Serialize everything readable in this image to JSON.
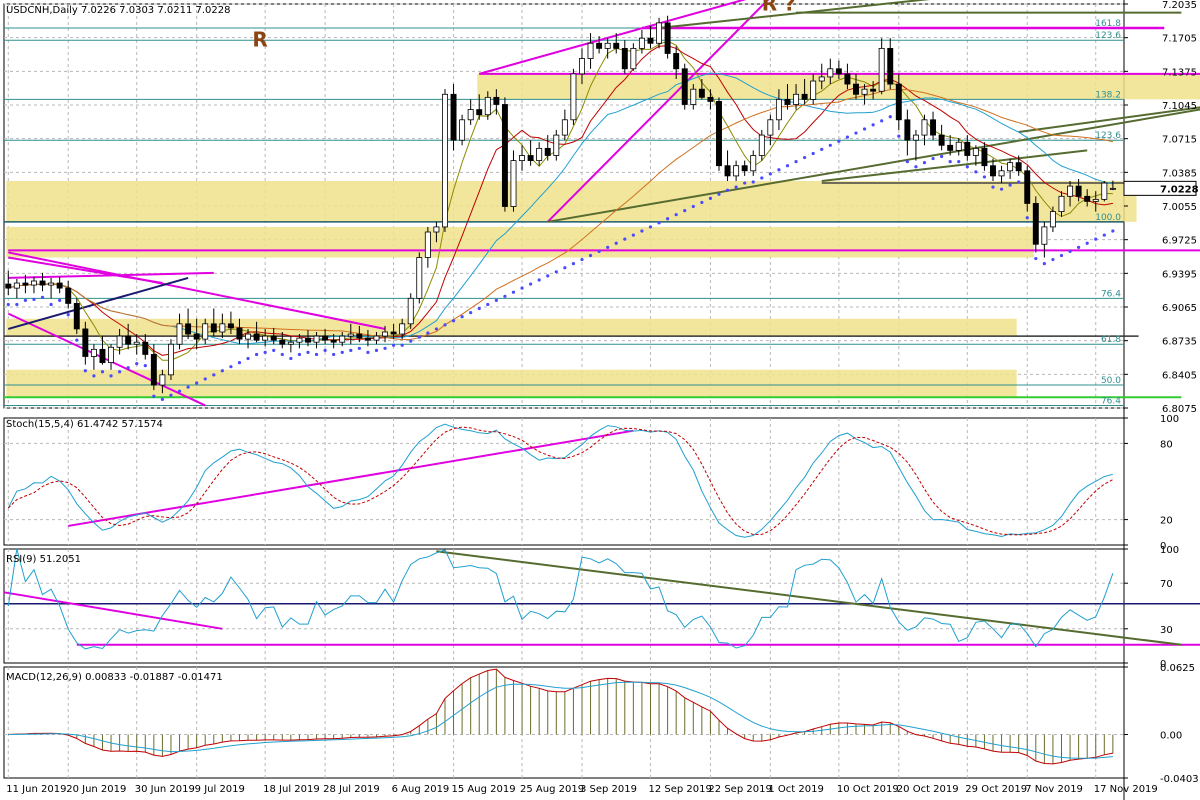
{
  "chart_data": [
    {
      "id": "price",
      "type": "candlestick",
      "title": "USDCNH,Daily",
      "ohlc_text": "7.0226 7.0303 7.0211 7.0228",
      "current_price_label": "7.0228",
      "ylim": [
        6.8075,
        7.2035
      ],
      "y_ticks": [
        "7.2035",
        "7.1705",
        "7.1375",
        "7.1045",
        "7.0715",
        "7.0385",
        "7.0055",
        "6.9725",
        "6.9395",
        "6.9065",
        "6.8735",
        "6.8405",
        "6.8075"
      ],
      "fib_labels": [
        {
          "text": "161.8",
          "value": 7.18
        },
        {
          "text": "123.6",
          "value": 7.168
        },
        {
          "text": "138.2",
          "value": 7.11
        },
        {
          "text": "123.6",
          "value": 7.07
        },
        {
          "text": "100.0",
          "value": 6.99
        },
        {
          "text": "76.4",
          "value": 6.915
        },
        {
          "text": "61.8",
          "value": 6.87
        },
        {
          "text": "50.0",
          "value": 6.83
        },
        {
          "text": "76.4",
          "value": 6.81
        }
      ],
      "annotations": [
        {
          "text": "R",
          "x": 28.5,
          "value": 7.162
        },
        {
          "text": "R ?",
          "x": 88,
          "value": 7.197
        }
      ],
      "candles": [
        [
          6.929,
          6.942,
          6.918,
          6.925
        ],
        [
          6.925,
          6.934,
          6.915,
          6.93
        ],
        [
          6.93,
          6.938,
          6.92,
          6.928
        ],
        [
          6.928,
          6.936,
          6.92,
          6.932
        ],
        [
          6.932,
          6.94,
          6.922,
          6.928
        ],
        [
          6.928,
          6.935,
          6.915,
          6.93
        ],
        [
          6.93,
          6.936,
          6.92,
          6.925
        ],
        [
          6.925,
          6.932,
          6.905,
          6.91
        ],
        [
          6.91,
          6.915,
          6.88,
          6.885
        ],
        [
          6.885,
          6.892,
          6.85,
          6.858
        ],
        [
          6.858,
          6.87,
          6.845,
          6.865
        ],
        [
          6.865,
          6.878,
          6.85,
          6.852
        ],
        [
          6.852,
          6.87,
          6.845,
          6.867
        ],
        [
          6.867,
          6.885,
          6.86,
          6.878
        ],
        [
          6.878,
          6.89,
          6.865,
          6.87
        ],
        [
          6.87,
          6.88,
          6.86,
          6.872
        ],
        [
          6.872,
          6.88,
          6.855,
          6.86
        ],
        [
          6.86,
          6.87,
          6.825,
          6.83
        ],
        [
          6.83,
          6.845,
          6.822,
          6.84
        ],
        [
          6.84,
          6.875,
          6.835,
          6.87
        ],
        [
          6.87,
          6.9,
          6.865,
          6.89
        ],
        [
          6.89,
          6.905,
          6.875,
          6.88
        ],
        [
          6.88,
          6.895,
          6.865,
          6.875
        ],
        [
          6.875,
          6.895,
          6.87,
          6.89
        ],
        [
          6.89,
          6.905,
          6.878,
          6.882
        ],
        [
          6.882,
          6.9,
          6.876,
          6.89
        ],
        [
          6.89,
          6.902,
          6.88,
          6.886
        ],
        [
          6.886,
          6.895,
          6.87,
          6.875
        ],
        [
          6.875,
          6.885,
          6.866,
          6.88
        ],
        [
          6.88,
          6.892,
          6.872,
          6.874
        ],
        [
          6.874,
          6.885,
          6.868,
          6.878
        ],
        [
          6.878,
          6.886,
          6.87,
          6.874
        ],
        [
          6.874,
          6.882,
          6.866,
          6.87
        ],
        [
          6.87,
          6.878,
          6.862,
          6.872
        ],
        [
          6.872,
          6.88,
          6.866,
          6.876
        ],
        [
          6.876,
          6.884,
          6.868,
          6.872
        ],
        [
          6.872,
          6.882,
          6.866,
          6.878
        ],
        [
          6.878,
          6.885,
          6.87,
          6.874
        ],
        [
          6.874,
          6.88,
          6.866,
          6.872
        ],
        [
          6.872,
          6.882,
          6.868,
          6.878
        ],
        [
          6.878,
          6.89,
          6.87,
          6.88
        ],
        [
          6.88,
          6.888,
          6.872,
          6.876
        ],
        [
          6.876,
          6.884,
          6.868,
          6.874
        ],
        [
          6.874,
          6.882,
          6.87,
          6.878
        ],
        [
          6.878,
          6.888,
          6.872,
          6.882
        ],
        [
          6.882,
          6.89,
          6.875,
          6.88
        ],
        [
          6.88,
          6.895,
          6.875,
          6.89
        ],
        [
          6.89,
          6.92,
          6.885,
          6.915
        ],
        [
          6.915,
          6.96,
          6.91,
          6.955
        ],
        [
          6.955,
          6.985,
          6.945,
          6.98
        ],
        [
          6.98,
          6.99,
          6.97,
          6.985
        ],
        [
          6.985,
          7.12,
          6.98,
          7.115
        ],
        [
          7.115,
          7.125,
          7.06,
          7.07
        ],
        [
          7.07,
          7.095,
          7.065,
          7.09
        ],
        [
          7.09,
          7.11,
          7.085,
          7.1
        ],
        [
          7.1,
          7.115,
          7.09,
          7.095
        ],
        [
          7.095,
          7.118,
          7.09,
          7.112
        ],
        [
          7.112,
          7.12,
          7.095,
          7.105
        ],
        [
          7.105,
          7.112,
          7.0,
          7.005
        ],
        [
          7.005,
          7.06,
          7.0,
          7.05
        ],
        [
          7.05,
          7.065,
          7.04,
          7.055
        ],
        [
          7.055,
          7.07,
          7.045,
          7.05
        ],
        [
          7.05,
          7.068,
          7.045,
          7.062
        ],
        [
          7.062,
          7.075,
          7.05,
          7.055
        ],
        [
          7.055,
          7.08,
          7.05,
          7.075
        ],
        [
          7.075,
          7.1,
          7.07,
          7.09
        ],
        [
          7.09,
          7.14,
          7.085,
          7.135
        ],
        [
          7.135,
          7.16,
          7.125,
          7.15
        ],
        [
          7.15,
          7.175,
          7.14,
          7.165
        ],
        [
          7.165,
          7.172,
          7.155,
          7.16
        ],
        [
          7.16,
          7.17,
          7.15,
          7.165
        ],
        [
          7.165,
          7.175,
          7.155,
          7.16
        ],
        [
          7.16,
          7.168,
          7.135,
          7.14
        ],
        [
          7.14,
          7.165,
          7.138,
          7.16
        ],
        [
          7.16,
          7.178,
          7.155,
          7.17
        ],
        [
          7.17,
          7.182,
          7.16,
          7.165
        ],
        [
          7.165,
          7.19,
          7.16,
          7.185
        ],
        [
          7.185,
          7.192,
          7.15,
          7.155
        ],
        [
          7.155,
          7.162,
          7.13,
          7.14
        ],
        [
          7.14,
          7.145,
          7.1,
          7.105
        ],
        [
          7.105,
          7.125,
          7.1,
          7.12
        ],
        [
          7.12,
          7.13,
          7.11,
          7.112
        ],
        [
          7.112,
          7.12,
          7.1,
          7.108
        ],
        [
          7.108,
          7.112,
          7.04,
          7.045
        ],
        [
          7.045,
          7.06,
          7.03,
          7.035
        ],
        [
          7.035,
          7.05,
          7.03,
          7.045
        ],
        [
          7.045,
          7.05,
          7.035,
          7.04
        ],
        [
          7.04,
          7.06,
          7.035,
          7.055
        ],
        [
          7.055,
          7.08,
          7.05,
          7.075
        ],
        [
          7.075,
          7.095,
          7.065,
          7.09
        ],
        [
          7.09,
          7.12,
          7.08,
          7.11
        ],
        [
          7.11,
          7.125,
          7.1,
          7.105
        ],
        [
          7.105,
          7.125,
          7.1,
          7.115
        ],
        [
          7.115,
          7.13,
          7.105,
          7.11
        ],
        [
          7.11,
          7.135,
          7.105,
          7.128
        ],
        [
          7.128,
          7.145,
          7.12,
          7.132
        ],
        [
          7.132,
          7.15,
          7.125,
          7.14
        ],
        [
          7.14,
          7.148,
          7.13,
          7.135
        ],
        [
          7.135,
          7.145,
          7.12,
          7.125
        ],
        [
          7.125,
          7.135,
          7.11,
          7.115
        ],
        [
          7.115,
          7.125,
          7.105,
          7.12
        ],
        [
          7.12,
          7.128,
          7.11,
          7.118
        ],
        [
          7.118,
          7.17,
          7.115,
          7.16
        ],
        [
          7.16,
          7.17,
          7.12,
          7.125
        ],
        [
          7.125,
          7.135,
          7.08,
          7.09
        ],
        [
          7.09,
          7.1,
          7.055,
          7.07
        ],
        [
          7.07,
          7.08,
          7.05,
          7.075
        ],
        [
          7.075,
          7.095,
          7.065,
          7.09
        ],
        [
          7.09,
          7.098,
          7.07,
          7.075
        ],
        [
          7.075,
          7.085,
          7.06,
          7.065
        ],
        [
          7.065,
          7.075,
          7.055,
          7.06
        ],
        [
          7.06,
          7.072,
          7.055,
          7.068
        ],
        [
          7.068,
          7.075,
          7.05,
          7.055
        ],
        [
          7.055,
          7.065,
          7.045,
          7.062
        ],
        [
          7.062,
          7.068,
          7.04,
          7.045
        ],
        [
          7.045,
          7.052,
          7.03,
          7.035
        ],
        [
          7.035,
          7.045,
          7.028,
          7.04
        ],
        [
          7.04,
          7.052,
          7.032,
          7.048
        ],
        [
          7.048,
          7.055,
          7.035,
          7.04
        ],
        [
          7.04,
          7.045,
          7.0,
          7.008
        ],
        [
          7.008,
          7.015,
          6.96,
          6.968
        ],
        [
          6.968,
          6.99,
          6.955,
          6.985
        ],
        [
          6.985,
          7.005,
          6.98,
          7.0
        ],
        [
          7.0,
          7.02,
          6.995,
          7.015
        ],
        [
          7.015,
          7.03,
          7.005,
          7.025
        ],
        [
          7.025,
          7.032,
          7.01,
          7.015
        ],
        [
          7.015,
          7.022,
          7.005,
          7.01
        ],
        [
          7.01,
          7.02,
          7.0,
          7.012
        ],
        [
          7.012,
          7.03,
          7.01,
          7.028
        ],
        [
          7.0226,
          7.0303,
          7.0211,
          7.0228
        ]
      ]
    },
    {
      "id": "stoch",
      "type": "line",
      "title": "Stoch(15,5,4) 61.4742 57.1574",
      "ylim": [
        0,
        100
      ],
      "y_ticks": [
        "100",
        "80",
        "20",
        "0"
      ]
    },
    {
      "id": "rsi",
      "type": "line",
      "title": "RSI(9) 51.2051",
      "ylim": [
        0,
        100
      ],
      "y_ticks": [
        "100",
        "70",
        "30",
        "0"
      ]
    },
    {
      "id": "macd",
      "type": "bar",
      "title": "MACD(12,26,9) 0.00833 -0.01887 -0.01471",
      "ylim": [
        -0.0403,
        0.0625
      ],
      "y_ticks": [
        "0.0625",
        "0.00",
        "-0.0403"
      ]
    }
  ],
  "x_labels": [
    "11 Jun 2019",
    "20 Jun 2019",
    "30 Jun 2019",
    "9 Jul 2019",
    "18 Jul 2019",
    "28 Jul 2019",
    "6 Aug 2019",
    "15 Aug 2019",
    "25 Aug 2019",
    "3 Sep 2019",
    "12 Sep 2019",
    "22 Sep 2019",
    "1 Oct 2019",
    "10 Oct 2019",
    "20 Oct 2019",
    "29 Oct 2019",
    "7 Nov 2019",
    "17 Nov 2019"
  ],
  "colors": {
    "bull_candle": "#ffffff",
    "bear_candle": "#000000",
    "magenta": "#e000e0",
    "olive": "#556b2f",
    "blue_dots": "#4a4aff",
    "fib": "#2f8f8f",
    "zone": "#f0e28c",
    "green": "#33cc33",
    "navy": "#1a1a70"
  }
}
